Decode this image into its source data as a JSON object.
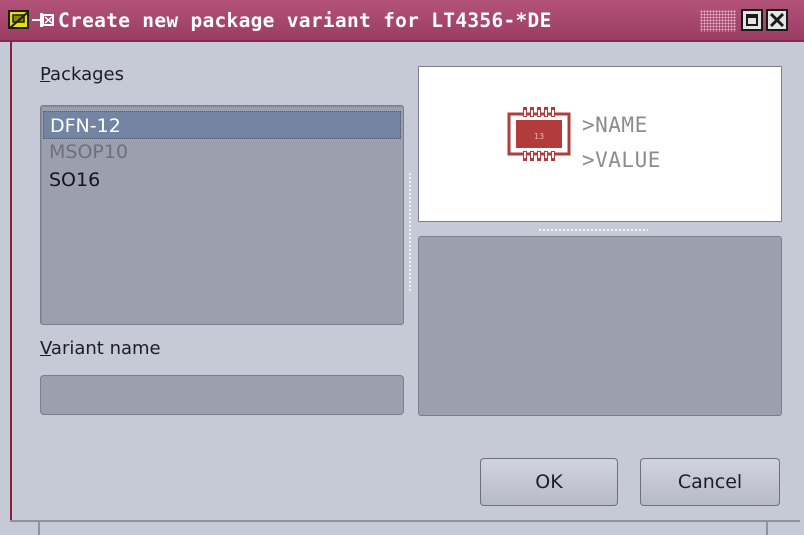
{
  "window": {
    "title": "Create new package variant for LT4356-*DE",
    "icons": {
      "app": "eagle-app-icon",
      "pin": "pin-icon",
      "maximize": "maximize-icon",
      "close": "close-icon"
    }
  },
  "packages": {
    "label_mnemonic": "P",
    "label_rest": "ackages",
    "items": [
      {
        "label": "DFN-12",
        "state": "selected"
      },
      {
        "label": "MSOP10",
        "state": "disabled"
      },
      {
        "label": "SO16",
        "state": "normal"
      }
    ]
  },
  "preview": {
    "name_placeholder": ">NAME",
    "value_placeholder": ">VALUE",
    "glyph_label": "13"
  },
  "variant": {
    "label_mnemonic": "V",
    "label_rest": "ariant name",
    "value": "",
    "placeholder": ""
  },
  "buttons": {
    "ok": "OK",
    "cancel": "Cancel"
  },
  "colors": {
    "titlebar": "#b3537a",
    "accent_footprint": "#b23b3b",
    "selection": "#7485a4"
  }
}
